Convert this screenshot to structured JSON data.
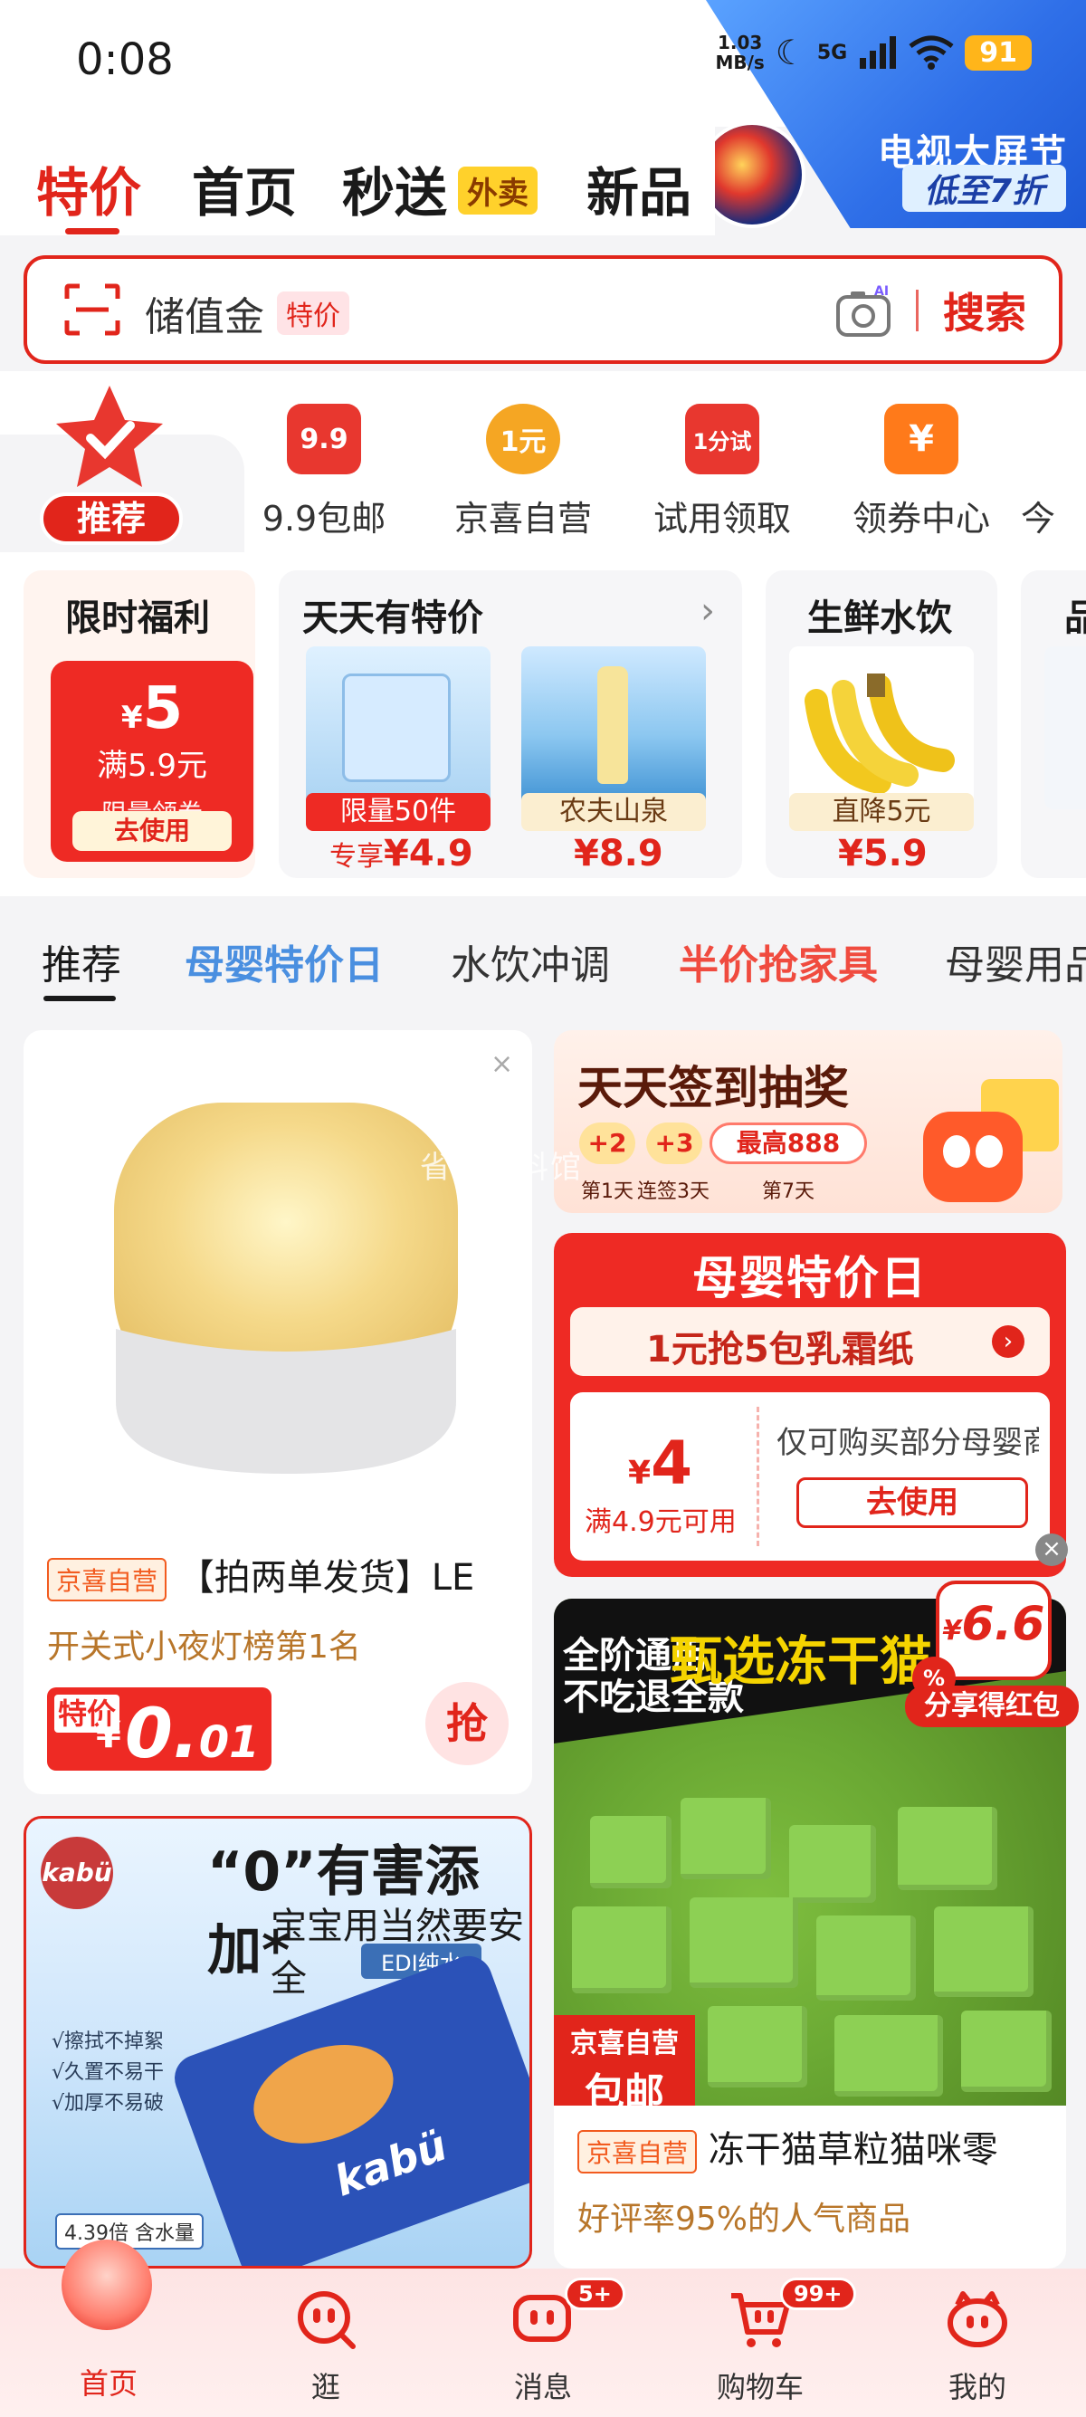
{
  "status_bar": {
    "time": "0:08",
    "net_speed": "1.03",
    "net_unit": "MB/s",
    "network": "5G",
    "battery": "91"
  },
  "promo": {
    "title": "电视大屏节",
    "subtitle": "低至7折"
  },
  "top_tabs": [
    {
      "label": "特价",
      "active": true
    },
    {
      "label": "首页"
    },
    {
      "label": "秒送",
      "badge": "外卖"
    },
    {
      "label": "新品"
    }
  ],
  "search": {
    "value": "储值金",
    "tag": "特价",
    "button": "搜索"
  },
  "quick_icons": {
    "recommend": "推荐",
    "items": [
      {
        "icon": "9.9",
        "label": "9.9包邮",
        "color": "#e8372f"
      },
      {
        "icon": "1元",
        "label": "京喜自营",
        "color": "#f5a623"
      },
      {
        "icon": "1分试",
        "label": "试用领取",
        "color": "#e8372f"
      },
      {
        "icon": "¥",
        "label": "领券中心",
        "color": "#ff7a1a"
      },
      {
        "icon": "",
        "label": "今"
      }
    ]
  },
  "deals": {
    "limited": {
      "title": "限时福利",
      "amount": "5",
      "currency": "¥",
      "condition": "满5.9元",
      "limit_text": "限量领券",
      "use": "去使用"
    },
    "daily": {
      "title": "天天有特价",
      "items": [
        {
          "tag": "限量50件",
          "price_lead": "专享",
          "price": "¥4.9"
        },
        {
          "tag": "农夫山泉",
          "price": "¥8.9"
        }
      ]
    },
    "fresh": {
      "title": "生鲜水饮",
      "tag": "直降5元",
      "price": "¥5.9"
    },
    "extra": {
      "title": "品"
    }
  },
  "category_tabs": [
    {
      "label": "推荐",
      "style": "active"
    },
    {
      "label": "母婴特价日",
      "style": "blue"
    },
    {
      "label": "水饮冲调",
      "style": "normal"
    },
    {
      "label": "半价抢家具",
      "style": "red"
    },
    {
      "label": "母婴用品",
      "style": "normal"
    }
  ],
  "feed": {
    "lamp": {
      "badge": "京喜自营",
      "title": "【拍两单发货】LE",
      "subtitle": "开关式小夜灯榜第1名",
      "price_tag": "特价",
      "currency": "¥",
      "price": "0.01",
      "grab": "抢"
    },
    "signin": {
      "title": "天天签到抽奖",
      "bubbles": [
        "+2",
        "+3"
      ],
      "max": "最高888",
      "days": [
        "第1天",
        "连签3天",
        "第7天"
      ]
    },
    "muying": {
      "title": "母婴特价日",
      "banner": "1元抢5包乳霜纸",
      "amount": "4",
      "currency": "¥",
      "condition": "满4.9元可用",
      "desc": "仅可购买部分母婴商",
      "use": "去使用"
    },
    "freeze": {
      "box_line1": "全阶通用",
      "box_line2": "不吃退全款",
      "headline": "甄选冻干猫",
      "share_price": "6.6",
      "share_label": "分享得红包",
      "badge_line1": "京喜自营",
      "badge_line2": "包邮",
      "shop_badge": "京喜自营",
      "title": "冻干猫草粒猫咪零",
      "subtitle": "好评率95%的人气商品"
    },
    "kabu": {
      "logo": "kabü",
      "headline": "“0”有害添加*",
      "sub": "宝宝用当然要安全",
      "edi": "EDI纯水",
      "features": [
        "√擦拭不掉絮",
        "√久置不易干",
        "√加厚不易破"
      ],
      "volume": "4.39倍 含水量",
      "pack_brand": "kabü"
    },
    "watermark": "省钱爆料馆"
  },
  "bottom_nav": [
    {
      "label": "首页",
      "active": true
    },
    {
      "label": "逛"
    },
    {
      "label": "消息",
      "badge": "5+"
    },
    {
      "label": "购物车",
      "badge": "99+"
    },
    {
      "label": "我的"
    }
  ]
}
